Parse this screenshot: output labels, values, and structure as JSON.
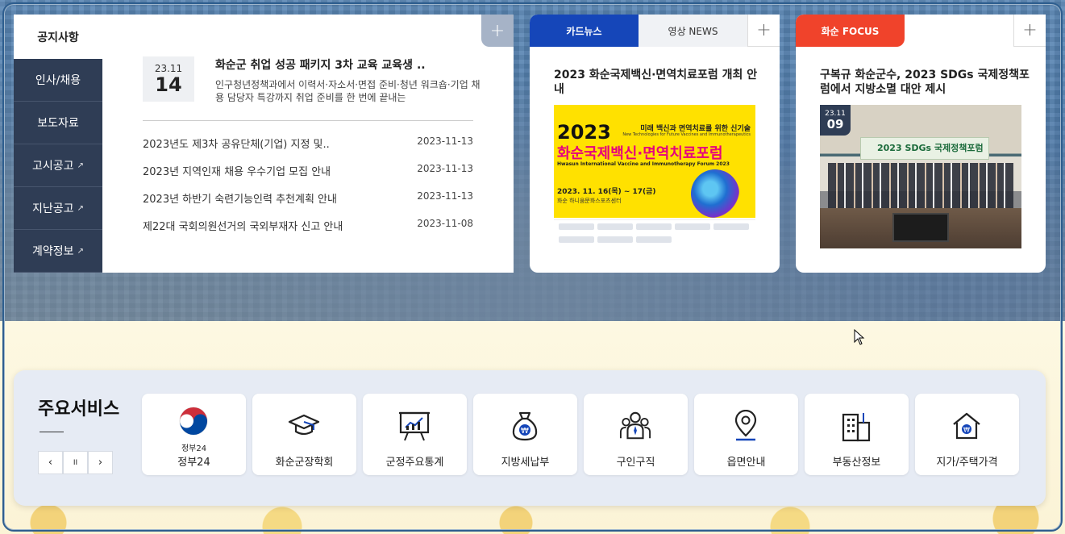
{
  "notice": {
    "tab_active": "공지사항",
    "side_menu": [
      {
        "label": "인사/채용",
        "external": false
      },
      {
        "label": "보도자료",
        "external": false
      },
      {
        "label": "고시공고",
        "external": true
      },
      {
        "label": "지난공고",
        "external": true
      },
      {
        "label": "계약정보",
        "external": true
      }
    ],
    "plus": "+",
    "featured": {
      "date_md": "23.11",
      "date_d": "14",
      "title": "화순군 취업 성공 패키지 3차 교육 교육생 ..",
      "desc": "인구청년정책과에서 이력서·자소서·면접 준비·청년 워크숍·기업 채용 담당자 특강까지 취업 준비를 한 번에 끝내는"
    },
    "list": [
      {
        "title": "2023년도 제3차 공유단체(기업) 지정 및..",
        "date": "2023-11-13"
      },
      {
        "title": "2023년 지역인재 채용 우수기업 모집 안내",
        "date": "2023-11-13"
      },
      {
        "title": "2023년 하반기 숙련기능인력 추천계획 안내",
        "date": "2023-11-13"
      },
      {
        "title": "제22대 국회의원선거의 국외부재자 신고 안내",
        "date": "2023-11-08"
      }
    ]
  },
  "cardnews": {
    "tab_active": "카드뉴스",
    "tab_other": "영상 NEWS",
    "plus": "+",
    "title": "2023 화순국제백신·면역치료포럼 개최 안내",
    "poster": {
      "sub": "미래 백신과 면역치료를 위한 신기술",
      "sub_en": "New Technologies for Future Vaccines and Immunotherapeutics",
      "year": "2023",
      "name": "화순국제백신·면역치료포럼",
      "eng": "Hwasun International Vaccine and Immunotherapy Forum 2023",
      "date": "2023. 11. 16(목) ~ 17(금)",
      "venue": "화순 하니움문화스포츠센터"
    }
  },
  "focus": {
    "tab": "화순 FOCUS",
    "plus": "+",
    "title": "구복규 화순군수, 2023 SDGs 국제정책포럼에서 지방소멸 대안 제시",
    "date_md": "23.11",
    "date_d": "09",
    "banner": "2023 SDGs 국제정책포럼"
  },
  "services": {
    "title": "주요서비스",
    "controls": {
      "prev": "‹",
      "pause": "II",
      "next": "›"
    },
    "items": [
      {
        "label": "정부24",
        "icon": "gov24-logo-icon",
        "small": "정부24"
      },
      {
        "label": "화순군장학회",
        "icon": "graduation-cap-icon"
      },
      {
        "label": "군정주요통계",
        "icon": "statistics-board-icon"
      },
      {
        "label": "지방세납부",
        "icon": "money-bag-icon"
      },
      {
        "label": "구인구직",
        "icon": "people-icon"
      },
      {
        "label": "읍면안내",
        "icon": "map-pin-icon"
      },
      {
        "label": "부동산정보",
        "icon": "building-icon"
      },
      {
        "label": "지가/주택가격",
        "icon": "house-price-icon"
      }
    ]
  },
  "colors": {
    "sidebar": "#2f3d55",
    "cardnews_tab": "#1546b9",
    "focus_tab": "#f0432b",
    "services_bg": "#e6ebf4"
  }
}
